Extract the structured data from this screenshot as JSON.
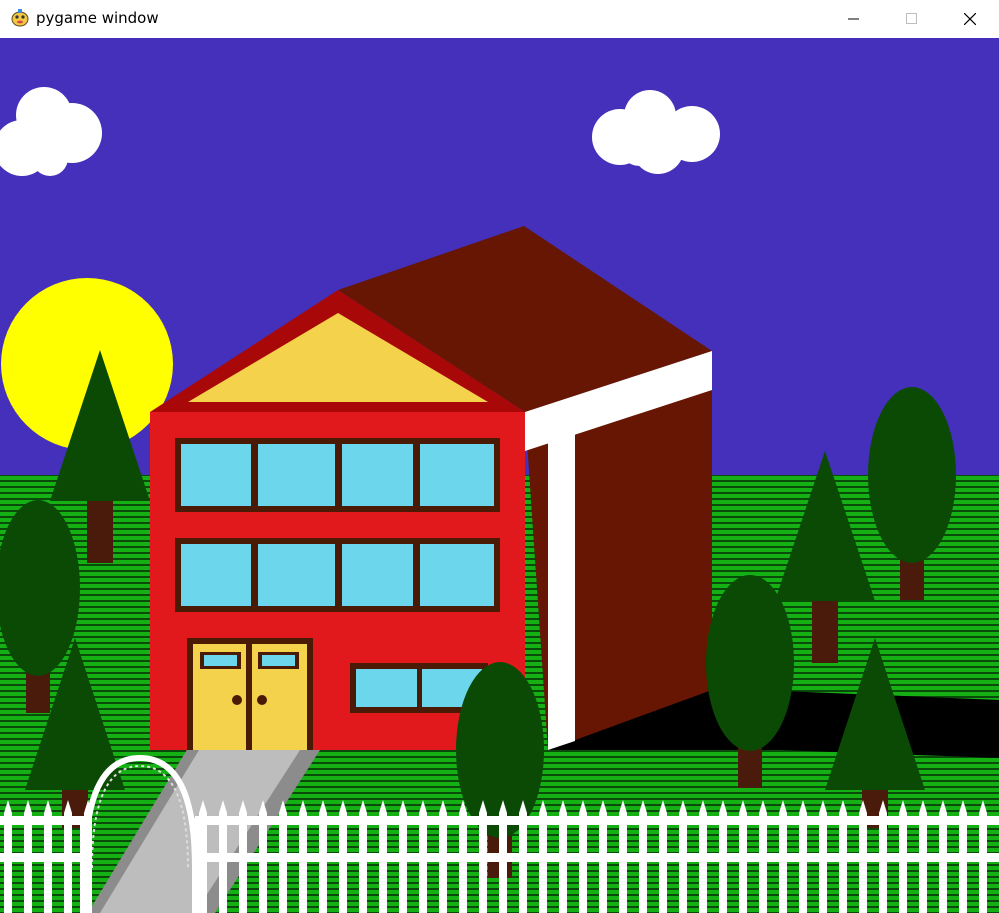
{
  "window": {
    "title": "pygame window",
    "icons": {
      "app": "pygame-snake-icon",
      "minimize": "minimize-icon",
      "maximize": "maximize-icon",
      "close": "close-icon"
    }
  },
  "scene": {
    "colors": {
      "sky": "#4430BA",
      "grass": "#14B014",
      "grass_stripe": "#0A4A0A",
      "sun": "#FFFF00",
      "cloud": "#FFFFFF",
      "house_front": "#E2191C",
      "house_side": "#661602",
      "gable_trim": "#A80808",
      "gable_fill": "#F5D24C",
      "window_glass": "#6BD6EC",
      "window_frame": "#4A1A04",
      "door": "#F5D24C",
      "fence": "#FFFFFF",
      "path_light": "#BDBDBD",
      "path_dark": "#8C8C8C",
      "tree_leaves": "#0A4A04",
      "tree_trunk": "#4A1A0A",
      "road": "#000000"
    }
  }
}
